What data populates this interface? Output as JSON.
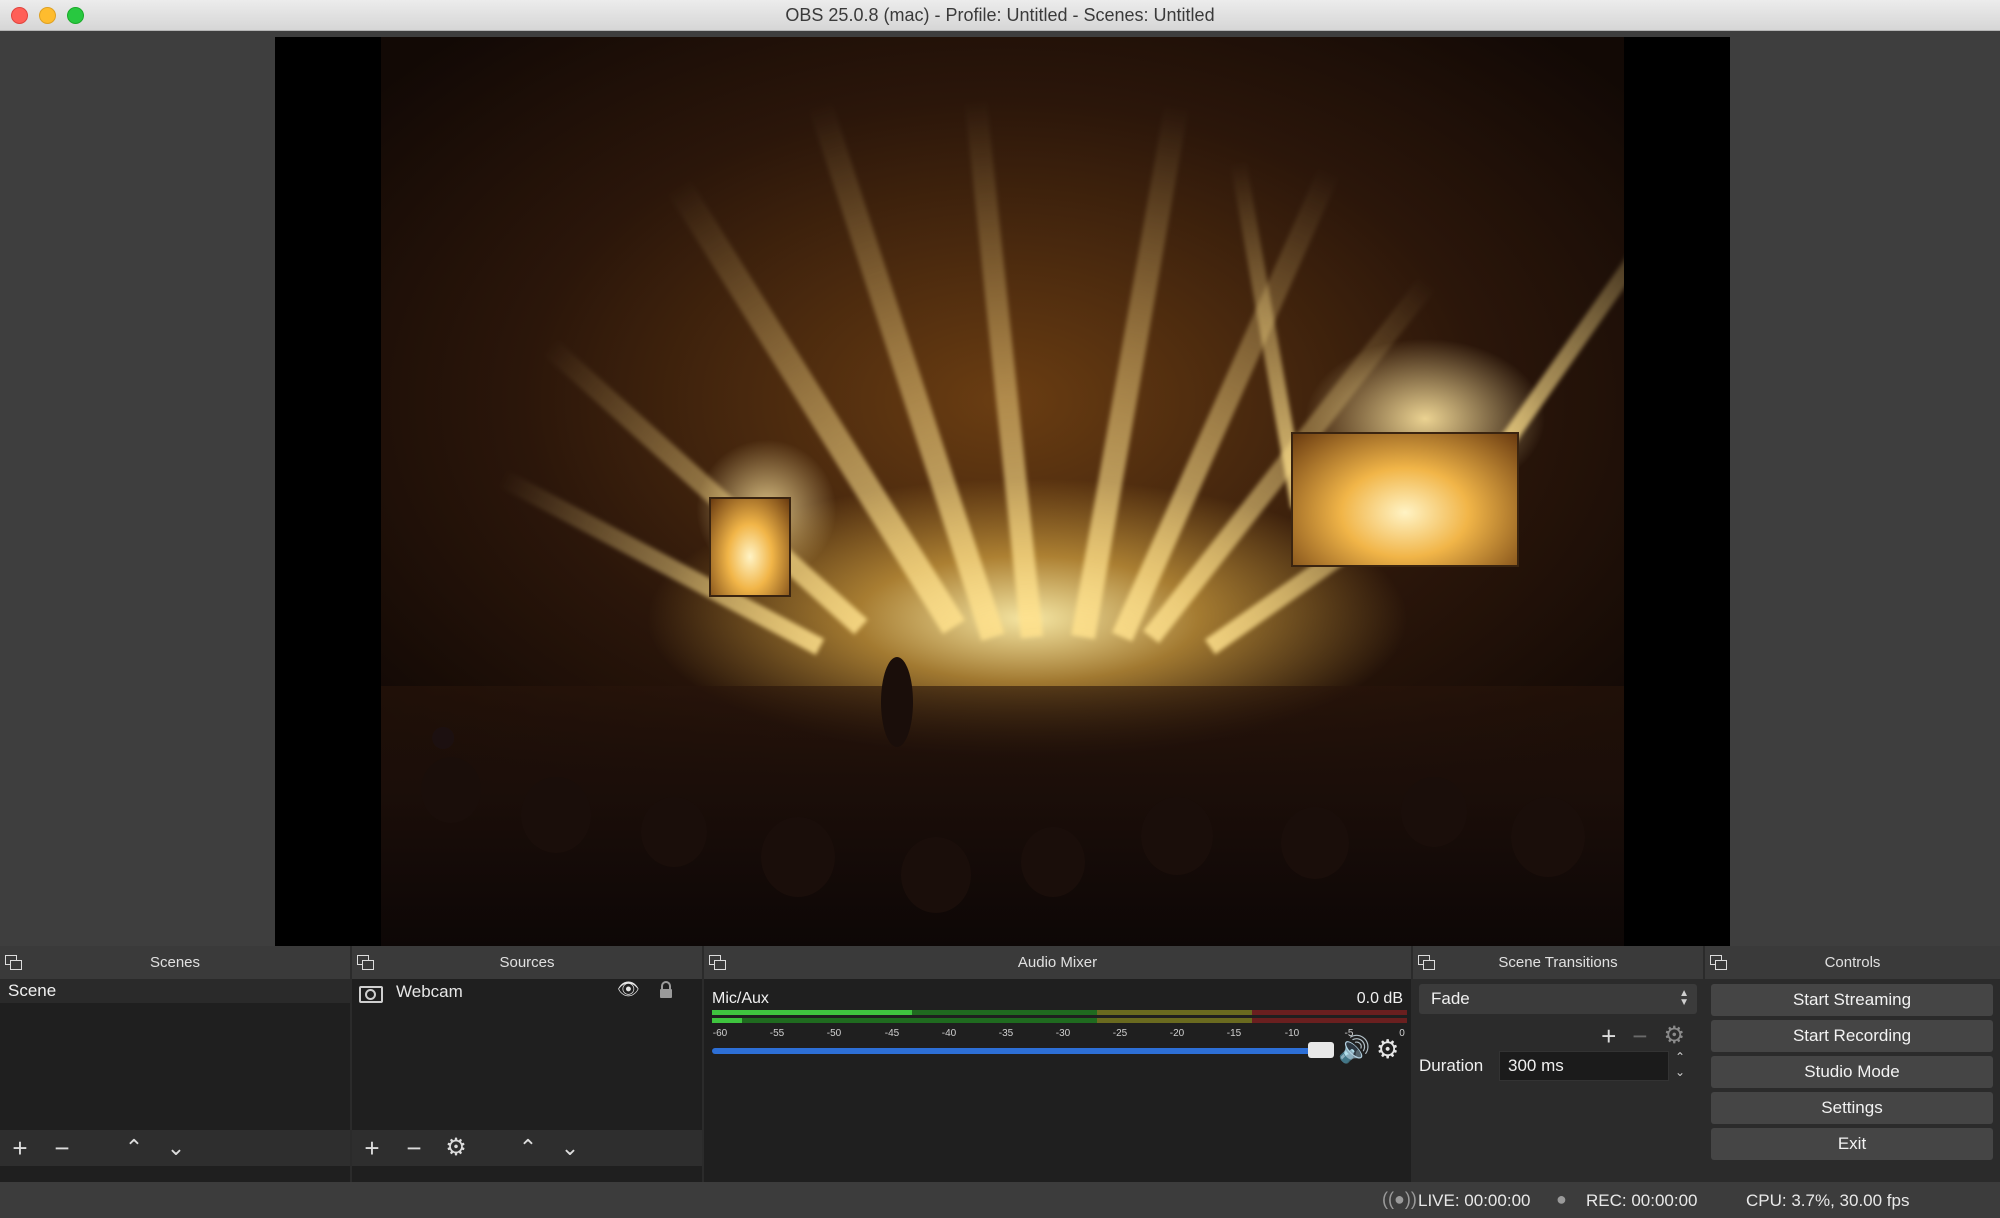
{
  "window": {
    "title": "OBS 25.0.8 (mac) - Profile: Untitled - Scenes: Untitled"
  },
  "docks": {
    "scenes": {
      "title": "Scenes",
      "items": [
        "Scene"
      ]
    },
    "sources": {
      "title": "Sources",
      "items": [
        {
          "name": "Webcam",
          "icon": "camera-icon"
        }
      ]
    },
    "audio_mixer": {
      "title": "Audio Mixer",
      "channel": {
        "name": "Mic/Aux",
        "level": "0.0 dB"
      },
      "ticks": [
        "-60",
        "-55",
        "-50",
        "-45",
        "-40",
        "-35",
        "-30",
        "-25",
        "-20",
        "-15",
        "-10",
        "-5",
        "0"
      ],
      "volume_fraction": 1.0
    },
    "scene_transitions": {
      "title": "Scene Transitions",
      "selected": "Fade",
      "duration_label": "Duration",
      "duration_value": "300 ms"
    },
    "controls": {
      "title": "Controls",
      "buttons": [
        "Start Streaming",
        "Start Recording",
        "Studio Mode",
        "Settings",
        "Exit"
      ]
    }
  },
  "status": {
    "live": "LIVE: 00:00:00",
    "rec": "REC: 00:00:00",
    "cpu": "CPU: 3.7%, 30.00 fps"
  },
  "colors": {
    "meter_green": "#3fc43f",
    "meter_yellow": "#c8b33a",
    "meter_red": "#c33a3a",
    "volume_blue": "#2d6fd6"
  }
}
